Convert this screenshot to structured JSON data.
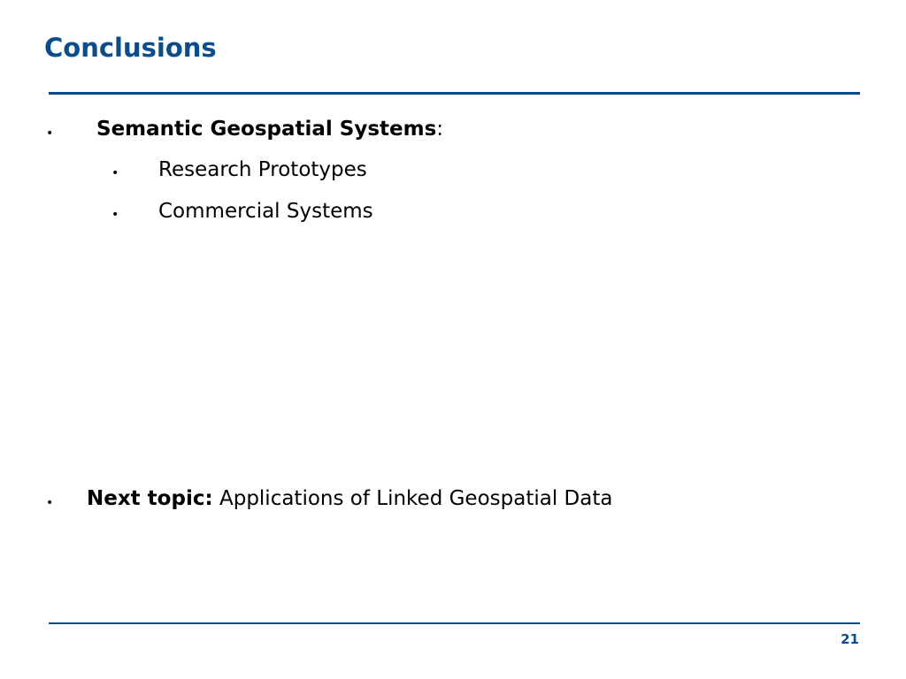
{
  "slide": {
    "title": "Conclusions",
    "page_number": "21",
    "accent_color": "#0a4d8c"
  },
  "bullets": {
    "item1": {
      "bullet": "•",
      "bold_text": "Semantic Geospatial Systems",
      "suffix": ":"
    },
    "item1_sub": [
      {
        "bullet": "•",
        "text": "Research Prototypes"
      },
      {
        "bullet": "•",
        "text": "Commercial Systems"
      }
    ],
    "item2": {
      "bullet": "•",
      "bold_text": "Next topic:",
      "text": " Applications of Linked Geospatial Data"
    }
  }
}
